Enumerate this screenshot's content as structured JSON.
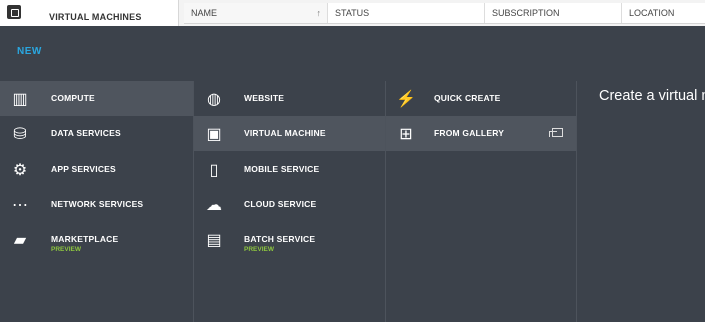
{
  "top": {
    "tab_label": "VIRTUAL MACHINES",
    "columns": [
      {
        "label": "NAME",
        "sort": "ascending"
      },
      {
        "label": "STATUS"
      },
      {
        "label": "SUBSCRIPTION"
      },
      {
        "label": "LOCATION"
      }
    ]
  },
  "new_panel": {
    "title": "NEW",
    "categories": [
      {
        "label": "COMPUTE",
        "icon": "compute-icon",
        "selected": true
      },
      {
        "label": "DATA SERVICES",
        "icon": "data-services-icon"
      },
      {
        "label": "APP SERVICES",
        "icon": "app-services-icon"
      },
      {
        "label": "NETWORK SERVICES",
        "icon": "network-services-icon"
      },
      {
        "label": "MARKETPLACE",
        "sub": "PREVIEW",
        "icon": "marketplace-icon"
      }
    ],
    "compute_items": [
      {
        "label": "WEBSITE",
        "icon": "globe-icon"
      },
      {
        "label": "VIRTUAL MACHINE",
        "icon": "virtual-machine-icon",
        "selected": true
      },
      {
        "label": "MOBILE SERVICE",
        "icon": "mobile-icon"
      },
      {
        "label": "CLOUD SERVICE",
        "icon": "cloud-icon"
      },
      {
        "label": "BATCH SERVICE",
        "sub": "PREVIEW",
        "icon": "batch-icon"
      }
    ],
    "create_options": [
      {
        "label": "QUICK CREATE",
        "icon": "lightning-icon"
      },
      {
        "label": "FROM GALLERY",
        "icon": "gallery-icon",
        "selected": true
      }
    ],
    "description": "Create a virtual m advanced option"
  }
}
